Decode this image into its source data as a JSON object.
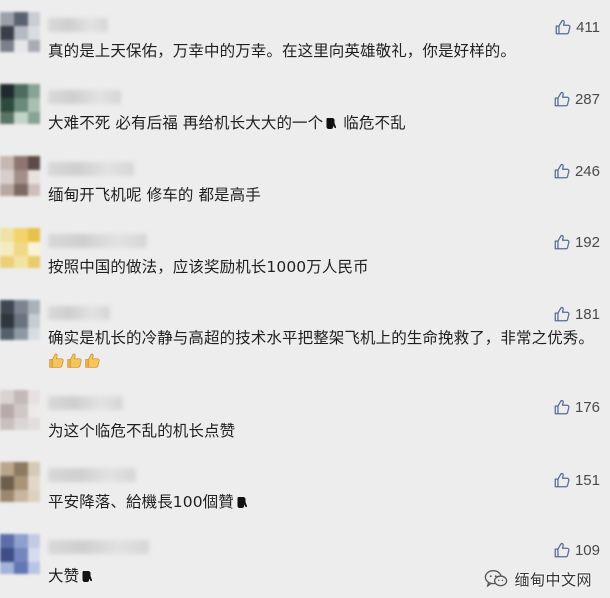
{
  "colors": {
    "background": "#ededed",
    "text": "#1f1f1f",
    "like_icon": "#576b95",
    "like_count": "#4a4a4a"
  },
  "comments": [
    {
      "text": "真的是上天保佑，万幸中的万幸。在这里向英雄敬礼，你是好样的。",
      "likes": "411",
      "avatar_colors": [
        "#9aa0aa",
        "#5a6270",
        "#c9cdd4",
        "#3b3f48",
        "#b5bac2",
        "#d9dce0",
        "#7b808a",
        "#e5e6e8",
        "#a7abb3"
      ]
    },
    {
      "text": "大难不死 必有后福 再给机长大大的一个",
      "text_after": " 临危不乱",
      "emoji": "down-pointing-hand-icon",
      "likes": "287",
      "avatar_colors": [
        "#1f2a2e",
        "#4d6b5f",
        "#87a394",
        "#2e4a3f",
        "#6c8a7a",
        "#a9bfb2",
        "#5a7466",
        "#c4d3ca",
        "#8aa295"
      ]
    },
    {
      "text": "缅甸开飞机呢  修车的  都是高手",
      "likes": "246",
      "avatar_colors": [
        "#c7b7b2",
        "#8e7670",
        "#5c4a47",
        "#d8cfcc",
        "#a38f89",
        "#e8e1de",
        "#b9a7a1",
        "#7d6a65",
        "#cdbfba"
      ]
    },
    {
      "text": "按照中国的做法，应该奖励机长1000万人民币",
      "likes": "192",
      "avatar_colors": [
        "#efe2a5",
        "#f2d46a",
        "#e7c24a",
        "#f6ebbf",
        "#f0d884",
        "#fbf3d6",
        "#ecd079",
        "#f4e3a0",
        "#e9cc6a"
      ]
    },
    {
      "text": "确实是机长的冷静与高超的技术水平把整架飞机上的生命挽救了，非常之优秀。",
      "emoji_tail": "thumbs-up-icon",
      "likes": "181",
      "avatar_colors": [
        "#3e4752",
        "#7b8591",
        "#a9b1bb",
        "#2f363f",
        "#6a737e",
        "#c6ccd3",
        "#55606c",
        "#8e98a3",
        "#d8dde2"
      ]
    },
    {
      "text": "为这个临危不乱的机长点赞",
      "likes": "176",
      "avatar_colors": [
        "#d9d2d2",
        "#c4b9b9",
        "#e6e0e0",
        "#b7a9a9",
        "#d0c7c7",
        "#ede9e9",
        "#c9bfbf",
        "#dcd5d5",
        "#e3dddd"
      ]
    },
    {
      "text": "平安降落、給機長100個贊",
      "emoji": "down-pointing-hand-icon",
      "likes": "151",
      "avatar_colors": [
        "#b9a58a",
        "#8c7a62",
        "#d6c9b6",
        "#6e5e4b",
        "#a89578",
        "#e2d8ca",
        "#9c8870",
        "#c7b79f",
        "#ddd1bf"
      ]
    },
    {
      "text": "大赞",
      "emoji": "down-pointing-hand-icon",
      "likes": "109",
      "avatar_colors": [
        "#5b6ea8",
        "#8fa0cf",
        "#c2cbe6",
        "#3f4f85",
        "#7486bd",
        "#d6dcef",
        "#a4b2da",
        "#6277b3",
        "#b9c3e3"
      ]
    }
  ],
  "watermark": {
    "text": "缅甸中文网",
    "icon": "wechat-icon"
  }
}
